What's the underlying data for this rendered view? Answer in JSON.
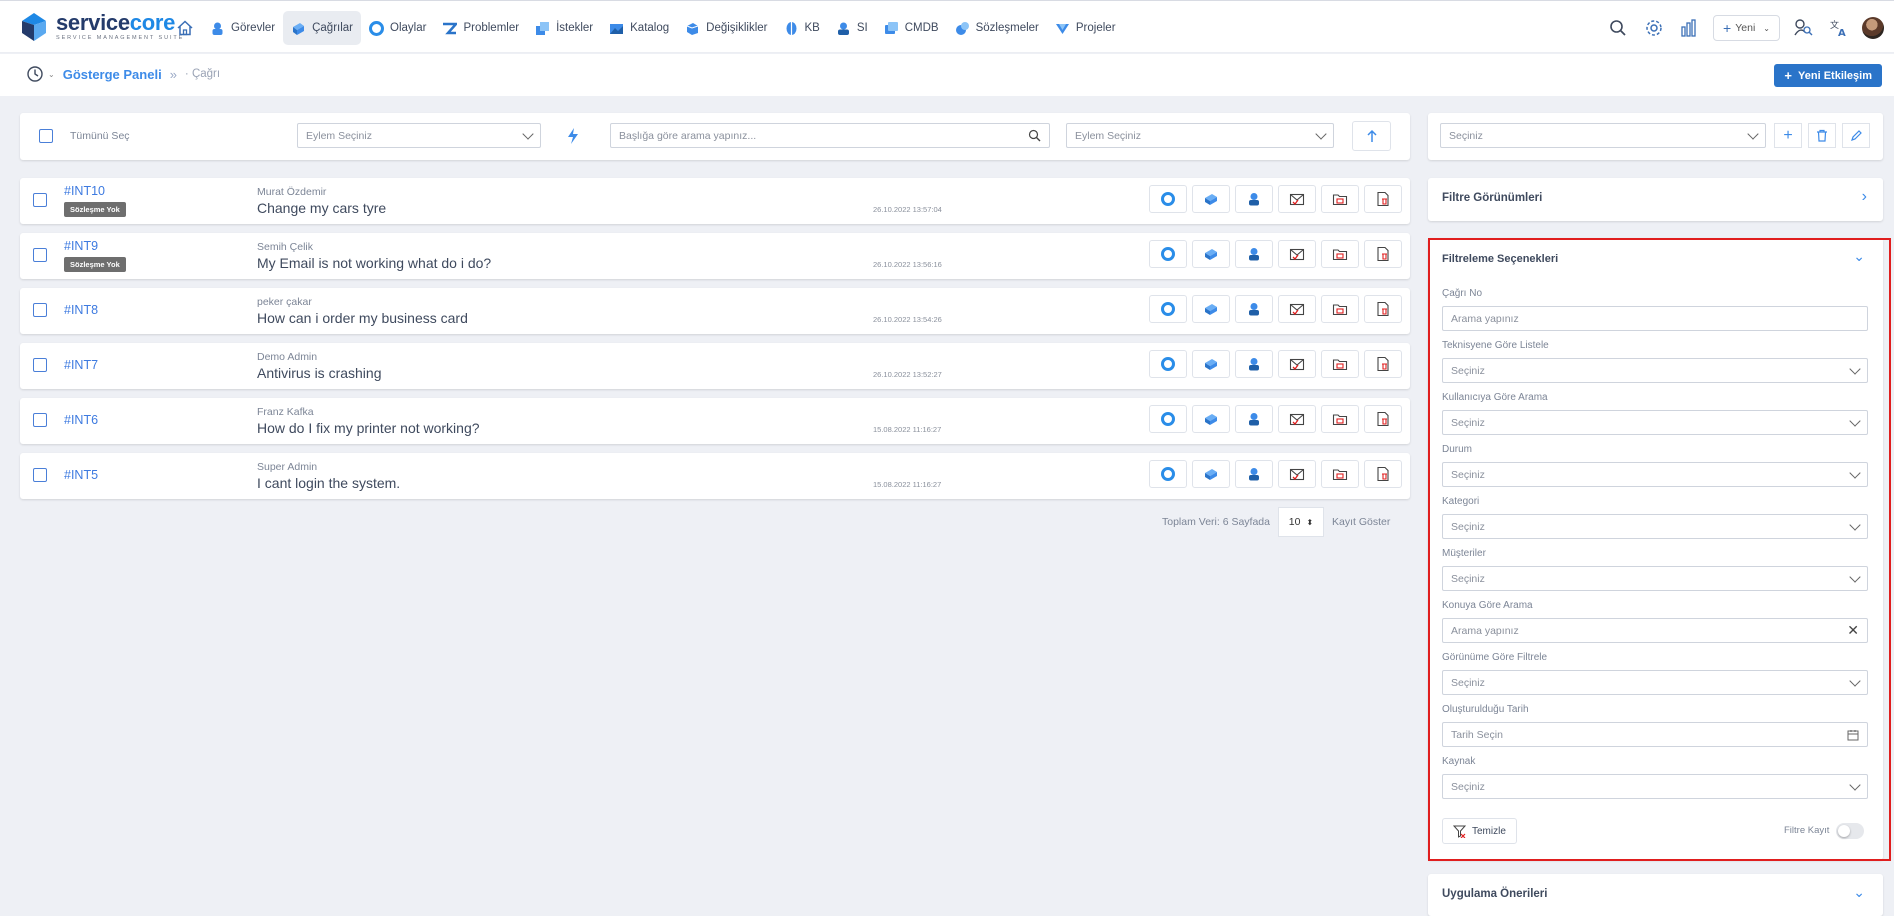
{
  "brand": {
    "name_part1": "service",
    "name_part2": "core",
    "subtitle": "SERVICE MANAGEMENT SUITE"
  },
  "nav": [
    {
      "label": "Görevler",
      "icon": "tasks-icon"
    },
    {
      "label": "Çağrılar",
      "icon": "calls-icon",
      "active": true
    },
    {
      "label": "Olaylar",
      "icon": "incidents-icon"
    },
    {
      "label": "Problemler",
      "icon": "problems-icon"
    },
    {
      "label": "İstekler",
      "icon": "requests-icon"
    },
    {
      "label": "Katalog",
      "icon": "catalog-icon"
    },
    {
      "label": "Değişiklikler",
      "icon": "changes-icon"
    },
    {
      "label": "KB",
      "icon": "kb-icon"
    },
    {
      "label": "SI",
      "icon": "si-icon"
    },
    {
      "label": "CMDB",
      "icon": "cmdb-icon"
    },
    {
      "label": "Sözleşmeler",
      "icon": "contracts-icon"
    },
    {
      "label": "Projeler",
      "icon": "projects-icon"
    }
  ],
  "toolbar_right": {
    "new_label": "Yeni"
  },
  "breadcrumb": {
    "home": "Gösterge Paneli",
    "current": "Çağrı"
  },
  "new_interaction_label": "Yeni Etkileşim",
  "list_toolbar": {
    "select_all": "Tümünü Seç",
    "action_placeholder": "Eylem Seçiniz",
    "search_placeholder": "Başlığa göre arama yapınız...",
    "action2_placeholder": "Eylem Seçiniz"
  },
  "rows": [
    {
      "id": "#INT10",
      "badge": "Sözleşme Yok",
      "user": "Murat Özdemir",
      "subject": "Change my cars tyre",
      "date": "26.10.2022 13:57:04"
    },
    {
      "id": "#INT9",
      "badge": "Sözleşme Yok",
      "user": "Semih Çelik",
      "subject": "My Email is not working what do i do?",
      "date": "26.10.2022 13:56:16"
    },
    {
      "id": "#INT8",
      "badge": "",
      "user": "peker çakar",
      "subject": "How can i order my business card",
      "date": "26.10.2022 13:54:26"
    },
    {
      "id": "#INT7",
      "badge": "",
      "user": "Demo Admin",
      "subject": "Antivirus is crashing",
      "date": "26.10.2022 13:52:27"
    },
    {
      "id": "#INT6",
      "badge": "",
      "user": "Franz Kafka",
      "subject": "How do I fix my printer not working?",
      "date": "15.08.2022 11:16:27"
    },
    {
      "id": "#INT5",
      "badge": "",
      "user": "Super Admin",
      "subject": "I cant login the system.",
      "date": "15.08.2022 11:16:27"
    }
  ],
  "pagination": {
    "total_text": "Toplam Veri: 6 Sayfada",
    "page_size": "10",
    "show_label": "Kayıt Göster"
  },
  "right_panel": {
    "view_select_placeholder": "Seçiniz",
    "filter_views_title": "Filtre Görünümleri",
    "filter_options_title": "Filtreleme Seçenekleri",
    "fields": [
      {
        "label": "Çağrı No",
        "type": "input",
        "value": "Arama yapınız"
      },
      {
        "label": "Teknisyene Göre Listele",
        "type": "select",
        "value": "Seçiniz"
      },
      {
        "label": "Kullanıcıya Göre Arama",
        "type": "select",
        "value": "Seçiniz"
      },
      {
        "label": "Durum",
        "type": "select",
        "value": "Seçiniz"
      },
      {
        "label": "Kategori",
        "type": "select",
        "value": "Seçiniz"
      },
      {
        "label": "Müşteriler",
        "type": "select",
        "value": "Seçiniz"
      },
      {
        "label": "Konuya Göre Arama",
        "type": "input-clear",
        "value": "Arama yapınız"
      },
      {
        "label": "Görünüme Göre Filtrele",
        "type": "select",
        "value": "Seçiniz"
      },
      {
        "label": "Oluşturulduğu Tarih",
        "type": "date",
        "value": "Tarih Seçin"
      },
      {
        "label": "Kaynak",
        "type": "select",
        "value": "Seçiniz"
      }
    ],
    "clear_label": "Temizle",
    "save_filter_label": "Filtre Kayıt",
    "suggestions_title": "Uygulama Önerileri"
  },
  "colors": {
    "accent": "#2a74c9",
    "link": "#3d7ae0",
    "highlight_border": "#e01e1e"
  }
}
